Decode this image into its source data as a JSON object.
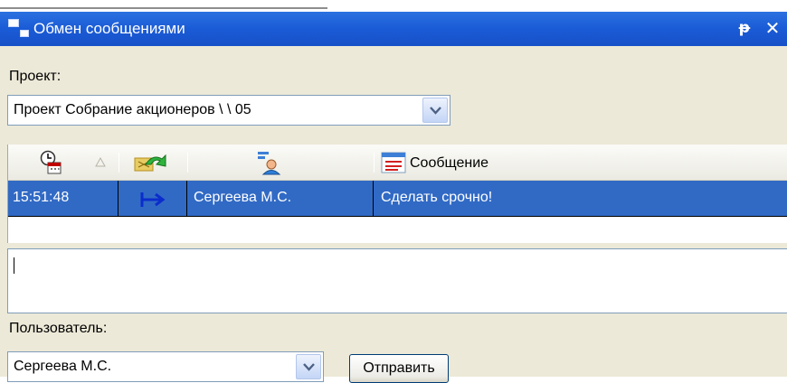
{
  "window": {
    "title": "Обмен сообщениями",
    "pin_glyph": "ᵽ",
    "close_glyph": "✕",
    "titlebar_color": "#1a5bd6"
  },
  "project": {
    "label": "Проект:",
    "selected": "Проект Собрание акционеров \\ \\ 05"
  },
  "grid": {
    "header": {
      "time_icon": "clock-calendar-icon",
      "direction_icon": "arrows-exchange-icon",
      "user_icon": "user-card-icon",
      "message_icon": "message-list-icon",
      "message_label": "Сообщение"
    },
    "rows": [
      {
        "time": "15:51:48",
        "direction": "↦",
        "user": "Сергеева М.С.",
        "message": "Сделать срочно!"
      }
    ],
    "selection_color": "#316ac5"
  },
  "message_input": {
    "value": ""
  },
  "user": {
    "label": "Пользователь:",
    "selected": "Сергеева М.С."
  },
  "send_button": {
    "label": "Отправить"
  }
}
